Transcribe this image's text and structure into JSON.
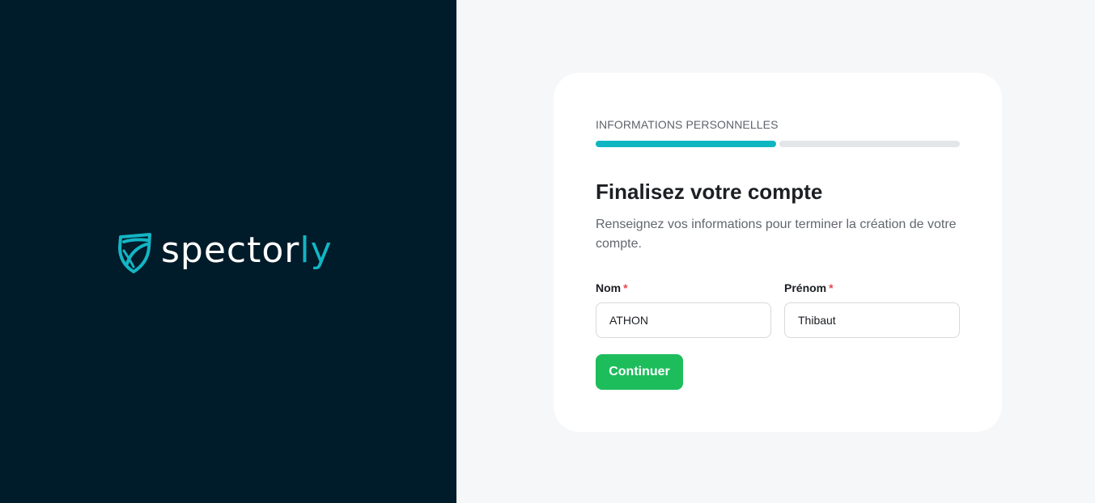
{
  "brand": {
    "name_main": "spector",
    "name_accent": "ly",
    "logo_icon": "shield-icon",
    "accent_color": "#13b5c4",
    "panel_color": "#001b29"
  },
  "card": {
    "step_label": "INFORMATIONS PERSONNELLES",
    "progress": {
      "current_step": 1,
      "total_steps": 2,
      "done_color": "#0fb6c2"
    },
    "title": "Finalisez votre compte",
    "subtitle": "Renseignez vos informations pour terminer la création de votre compte.",
    "fields": {
      "nom": {
        "label": "Nom",
        "required_mark": "*",
        "value": "ATHON"
      },
      "prenom": {
        "label": "Prénom",
        "required_mark": "*",
        "value": "Thibaut"
      }
    },
    "submit_label": "Continuer",
    "submit_color": "#1dbd5c"
  }
}
